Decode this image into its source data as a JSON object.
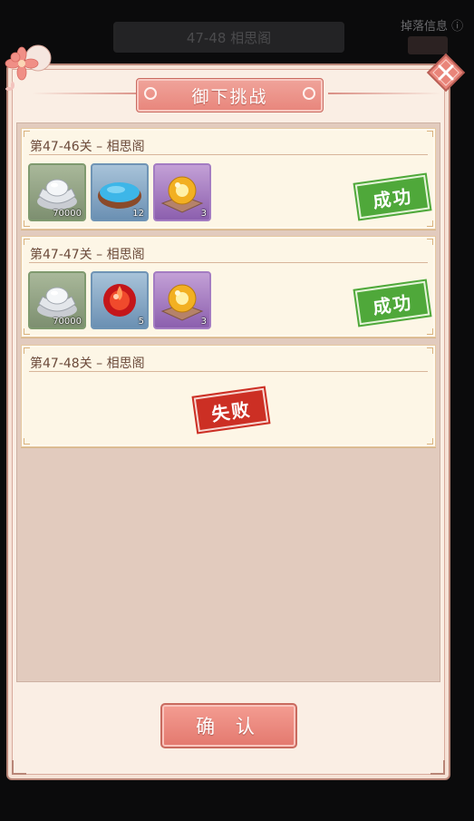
{
  "background": {
    "top_bar_text": "47-48 相思阁",
    "top_right_text": "掉落信息 ⓘ"
  },
  "dialog": {
    "title": "御下挑战",
    "confirm_label": "确 认"
  },
  "entries": [
    {
      "title": "第47-46关 – 相思阁",
      "result": "成功",
      "items": [
        {
          "icon": "silver-ingot-icon",
          "qty": "70000",
          "frame": "green"
        },
        {
          "icon": "blue-powder-bowl-icon",
          "qty": "12",
          "frame": "blue"
        },
        {
          "icon": "golden-orb-icon",
          "qty": "3",
          "frame": "purple"
        }
      ]
    },
    {
      "title": "第47-47关 – 相思阁",
      "result": "成功",
      "items": [
        {
          "icon": "silver-ingot-icon",
          "qty": "70000",
          "frame": "green"
        },
        {
          "icon": "red-flame-orb-icon",
          "qty": "5",
          "frame": "blue"
        },
        {
          "icon": "golden-orb-icon",
          "qty": "3",
          "frame": "purple"
        }
      ]
    },
    {
      "title": "第47-48关 – 相思阁",
      "result": "失败",
      "items": []
    }
  ],
  "colors": {
    "success": "#4fa83a",
    "fail": "#cc2f24",
    "accent": "#e8857b"
  }
}
